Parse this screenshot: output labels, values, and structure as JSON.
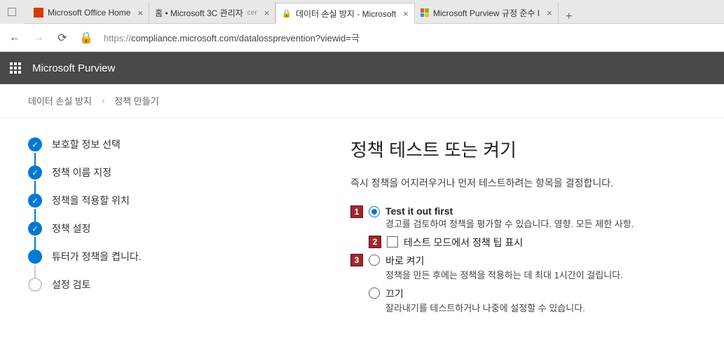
{
  "browser": {
    "tabs": [
      {
        "label": "Microsoft Office Home"
      },
      {
        "label": "홈 • Microsoft 3C 관리자",
        "suffix": "cer"
      },
      {
        "label": "데이터 손실 방지 - Microsoft"
      },
      {
        "label": "Microsoft Purview 규정 준수 I"
      }
    ],
    "url_protocol": "https://",
    "url_rest": "compliance.microsoft.com/datalossprevention?viewid=극"
  },
  "header": {
    "product": "Microsoft Purview"
  },
  "breadcrumb": {
    "a": "데이터 손실 방지",
    "b": "정책 만들기"
  },
  "steps": [
    {
      "label": "보호할 정보 선택",
      "state": "done"
    },
    {
      "label": "정책 이름 지정",
      "state": "done"
    },
    {
      "label": "정책을 적용할 위치",
      "state": "done"
    },
    {
      "label": "정책 설정",
      "state": "done"
    },
    {
      "label": "튜터가 정책을 켭니다.",
      "state": "current"
    },
    {
      "label": "설정 검토",
      "state": "pending"
    }
  ],
  "page": {
    "title": "정책 테스트 또는 켜기",
    "desc": "즉시 정책을 어지러우거나 먼저 테스트하려는 항목을 결정합니다.",
    "callouts": {
      "c1": "1",
      "c2": "2",
      "c3": "3"
    },
    "opt1_label": "Test it out first",
    "opt1_sub": "경고를 검토하여 정책을 평가할 수 있습니다. 영향. 모든 제한 사항.",
    "opt2_label": "테스트 모드에서 정책 팁 표시",
    "opt3_label": "바로 켜기",
    "opt3_sub": "정책을 만든 후에는 정책을 적용하는 데 최대 1시간이 걸립니다.",
    "opt4_label": "끄기",
    "opt4_sub": "잘라내기를 테스트하거나 나중에 설정할 수 있습니다."
  }
}
